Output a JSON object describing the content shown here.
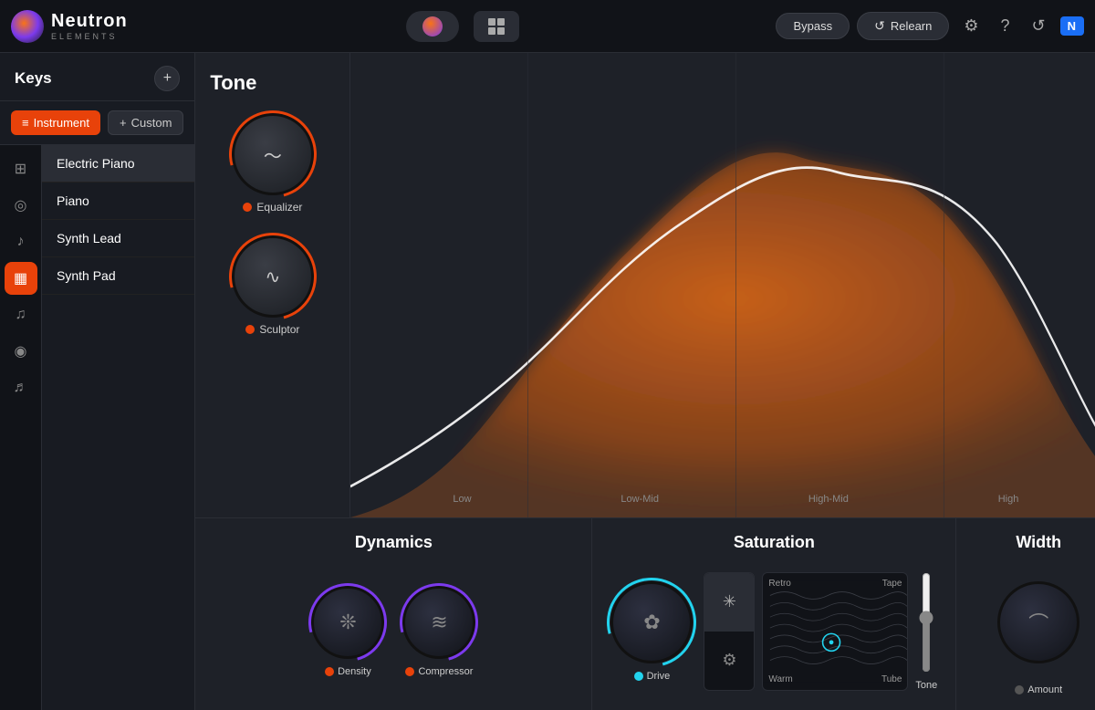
{
  "app": {
    "name": "Neutron",
    "sub": "ELEMENTS",
    "izologo": "N"
  },
  "header": {
    "bypass_label": "Bypass",
    "relearn_label": "Relearn",
    "settings_icon": "⚙",
    "help_icon": "?",
    "midi_icon": "↺"
  },
  "sidebar": {
    "title": "Keys",
    "add_icon": "+",
    "tabs": [
      {
        "id": "instrument",
        "label": "Instrument",
        "active": true
      },
      {
        "id": "custom",
        "label": "Custom",
        "active": false
      }
    ],
    "icons": [
      {
        "id": "eq-icon",
        "symbol": "⊞",
        "active": false
      },
      {
        "id": "target-icon",
        "symbol": "◎",
        "active": false
      },
      {
        "id": "guitar-icon",
        "symbol": "🎸",
        "active": false
      },
      {
        "id": "keyboard-icon",
        "symbol": "🎹",
        "active": true
      },
      {
        "id": "bass-icon",
        "symbol": "🎸",
        "active": false
      },
      {
        "id": "drums-icon",
        "symbol": "🥁",
        "active": false
      },
      {
        "id": "vocal-icon",
        "symbol": "🎤",
        "active": false
      }
    ],
    "instruments": [
      {
        "id": "electric-piano",
        "label": "Electric Piano",
        "active": true
      },
      {
        "id": "piano",
        "label": "Piano",
        "active": false
      },
      {
        "id": "synth-lead",
        "label": "Synth Lead",
        "active": false
      },
      {
        "id": "synth-pad",
        "label": "Synth Pad",
        "active": false
      }
    ]
  },
  "tone": {
    "title": "Tone",
    "equalizer_label": "Equalizer",
    "sculptor_label": "Sculptor",
    "freq_labels": [
      "Low",
      "Low-Mid",
      "High-Mid",
      "High"
    ]
  },
  "dynamics": {
    "title": "Dynamics",
    "density_label": "Density",
    "compressor_label": "Compressor"
  },
  "saturation": {
    "title": "Saturation",
    "drive_label": "Drive",
    "tone_label": "Tone",
    "selector": {
      "top_left": "Retro",
      "top_right": "Tape",
      "bottom_left": "Warm",
      "bottom_right": "Tube"
    }
  },
  "width": {
    "title": "Width",
    "amount_label": "Amount"
  }
}
